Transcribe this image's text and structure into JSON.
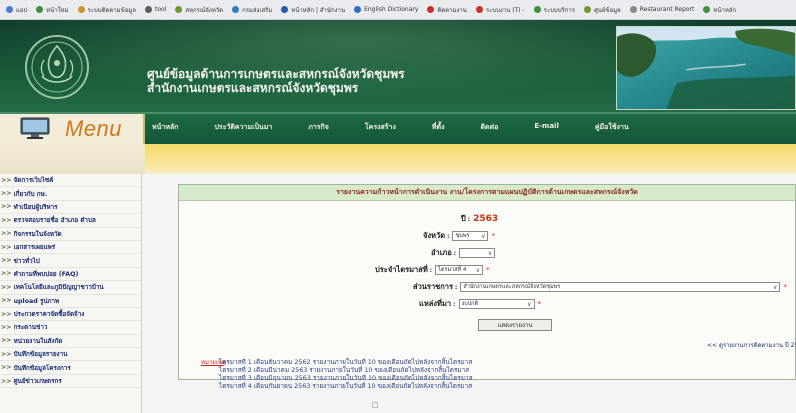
{
  "bookmarks": [
    {
      "label": "แอป",
      "color": "#4a7bd0"
    },
    {
      "label": "หน้าใหม่",
      "color": "#3d8f3d"
    },
    {
      "label": "ระบบติดตามข้อมูล",
      "color": "#d0912a"
    },
    {
      "label": "tool",
      "color": "#5a5a5a"
    },
    {
      "label": "สหกรณ์จังหวัด",
      "color": "#6e9a2c"
    },
    {
      "label": "กรมส่งเสริม",
      "color": "#2f7bbf"
    },
    {
      "label": "หน้าหลัก | สำนักงาน",
      "color": "#1f5ea8"
    },
    {
      "label": "English Dictionary",
      "color": "#2b6cc4"
    },
    {
      "label": "ติดตามงาน",
      "color": "#c9302c"
    },
    {
      "label": "ระบบงาน (T) -",
      "color": "#c9302c"
    },
    {
      "label": "ระบบบริการ",
      "color": "#3d8f3d"
    },
    {
      "label": "ศูนย์ข้อมูล",
      "color": "#6e9a2c"
    },
    {
      "label": "Restaurant Report",
      "color": "#888888"
    },
    {
      "label": "หน้าหลัก",
      "color": "#3d8f3d"
    }
  ],
  "header": {
    "title_line1": "ศูนย์ข้อมูลด้านการเกษตรและสหกรณ์จังหวัดชุมพร",
    "title_line2": "สำนักงานเกษตรและสหกรณ์จังหวัดชุมพร"
  },
  "menu": {
    "label": "Menu"
  },
  "nav": [
    "หน้าหลัก",
    "ประวัติความเป็นมา",
    "ภารกิจ",
    "โครงสร้าง",
    "ที่ตั้ง",
    "ติดต่อ",
    "E-mail",
    "คู่มือใช้งาน"
  ],
  "sidebar": {
    "items": [
      "จัดการเว็บไซต์",
      "เกี่ยวกับ กษ.",
      "ทำเนียบผู้บริหาร",
      "ตรวจสอบรายชื่อ อำเภอ ตำบล",
      "กิจกรรมในจังหวัด",
      "เอกสารเผยแพร่",
      "ข่าวทั่วไป",
      "คำถามที่พบบ่อย (FAQ)",
      "เทคโนโลยีและภูมิปัญญาชาวบ้าน",
      "upload รูปภาพ",
      "ประกวดราคาจัดซื้อจัดจ้าง",
      "กระดานข่าว",
      "หน่วยงานในสังกัด",
      "บันทึกข้อมูลรายงาน",
      "บันทึกข้อมูลโครงการ",
      "ศูนย์ข่าวเกษตรกร"
    ]
  },
  "report": {
    "title": "รายงานความก้าวหน้าการดำเนินงาน งาน/โครงการตามแผนปฏิบัติการด้านเกษตรและสหกรณ์จังหวัด",
    "year_label": "ปี :",
    "year_value": "2563",
    "province_label": "จังหวัด :",
    "province_value": "ชุมพร",
    "district_label": "อำเภอ :",
    "district_value": "",
    "quarter_label": "ประจำไตรมาสที่ :",
    "quarter_value": "ไตรมาสที่ 4",
    "agency_label": "ส่วนราชการ :",
    "agency_value": "สำนักงานเกษตรและสหกรณ์จังหวัดชุมพร",
    "fund_label": "แหล่งที่มา :",
    "fund_value": "งบปกติ",
    "required_mark": "*",
    "show_button": "แสดงรายงาน",
    "side_link": "<< ดูรายงานการติดตามงาน ปี 2549",
    "notes_header": "หมายเหตุ",
    "notes": [
      "ไตรมาสที่ 1 เดือนธันวาคม 2562 รายงานภายในวันที่ 10 ของเดือนถัดไปหลังจากสิ้นไตรมาส",
      "ไตรมาสที่ 2 เดือนมีนาคม 2563 รายงานภายในวันที่ 10 ของเดือนถัดไปหลังจากสิ้นไตรมาส",
      "ไตรมาสที่ 3 เดือนมิถุนายน 2563 รายงานภายในวันที่ 10 ของเดือนถัดไปหลังจากสิ้นไตรมาส",
      "ไตรมาสที่ 4 เดือนกันยายน 2563 รายงานภายในวันที่ 10 ของเดือนถัดไปหลังจากสิ้นไตรมาส"
    ]
  },
  "colors": {
    "header_green": "#185a3a",
    "menu_orange": "#ce7a1c",
    "year_red": "#d32e10",
    "link_blue": "#1a2d72"
  }
}
